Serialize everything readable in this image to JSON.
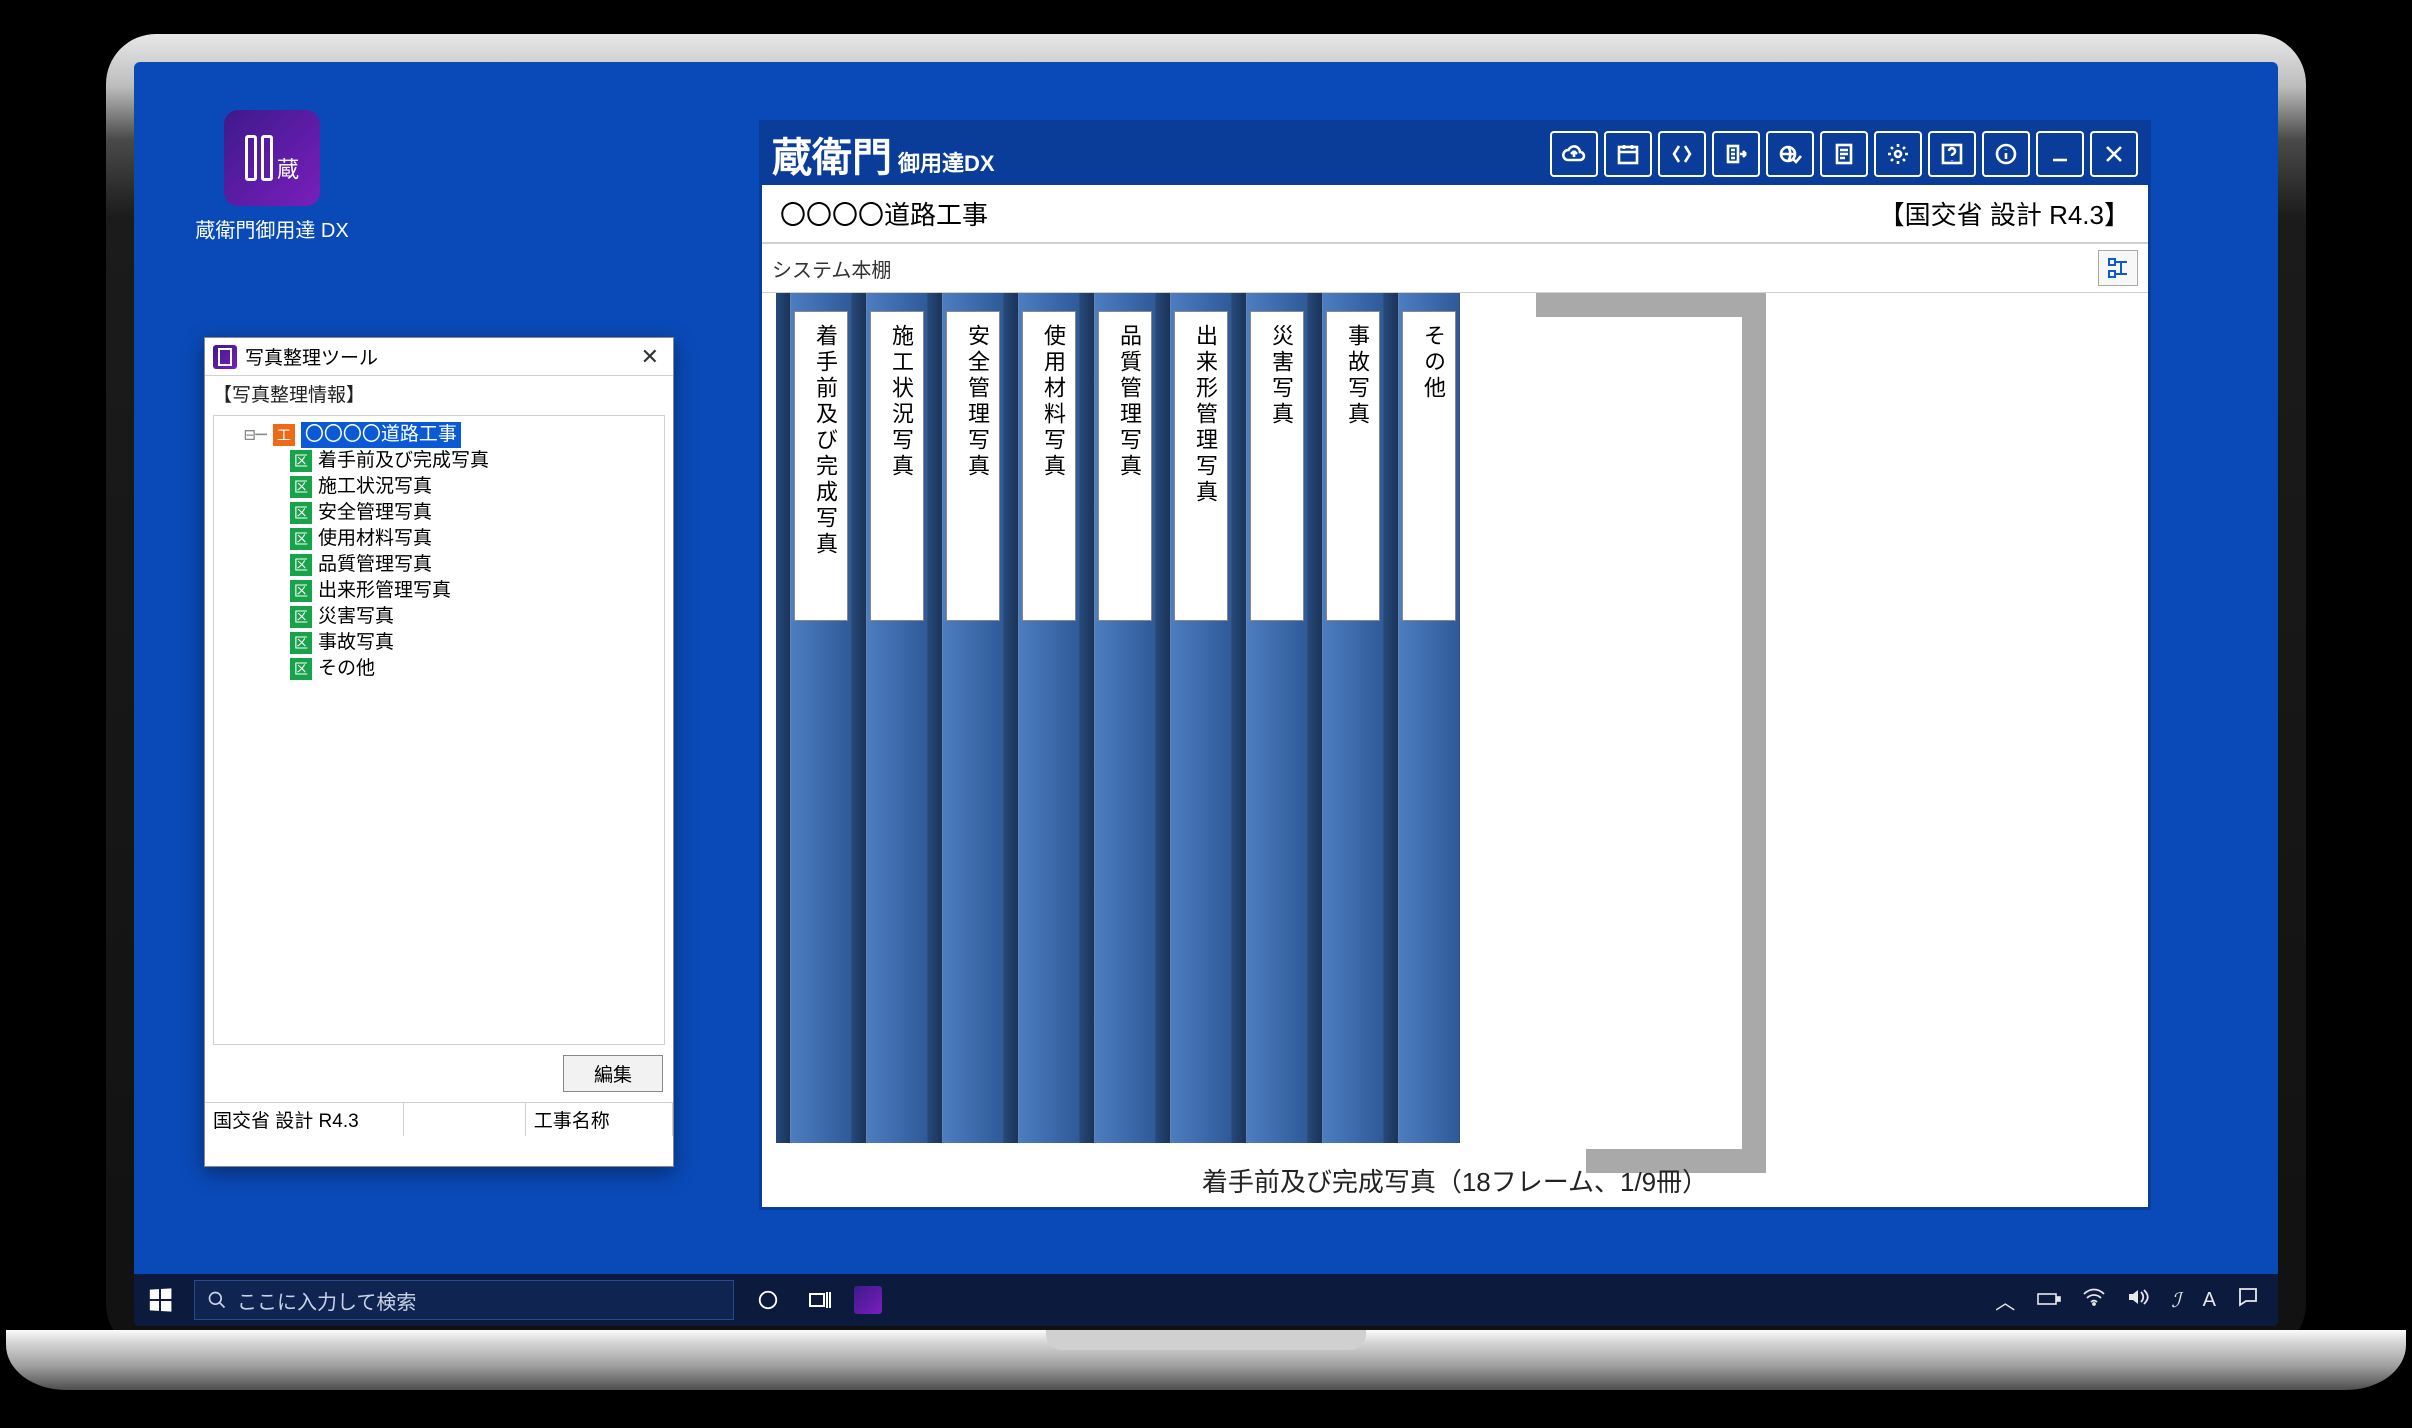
{
  "desktop_icon": {
    "label": "蔵衛門御用達 DX"
  },
  "tool_window": {
    "title": "写真整理ツール",
    "section_label": "【写真整理情報】",
    "root_label": "〇〇〇〇道路工事",
    "children": [
      "着手前及び完成写真",
      "施工状況写真",
      "安全管理写真",
      "使用材料写真",
      "品質管理写真",
      "出来形管理写真",
      "災害写真",
      "事故写真",
      "その他"
    ],
    "edit_button": "編集",
    "status_left": "国交省 設計 R4.3",
    "status_right": "工事名称"
  },
  "kura_window": {
    "logo_main": "蔵衛門",
    "logo_sub": "御用達DX",
    "project_title": "〇〇〇〇道路工事",
    "spec_label": "【国交省 設計 R4.3】",
    "shelf_title": "システム本棚",
    "books": [
      "着手前及び完成写真",
      "施工状況写真",
      "安全管理写真",
      "使用材料写真",
      "品質管理写真",
      "出来形管理写真",
      "災害写真",
      "事故写真",
      "その他"
    ],
    "caption": "着手前及び完成写真（18フレーム、1/9冊）"
  },
  "taskbar": {
    "search_placeholder": "ここに入力して検索"
  }
}
